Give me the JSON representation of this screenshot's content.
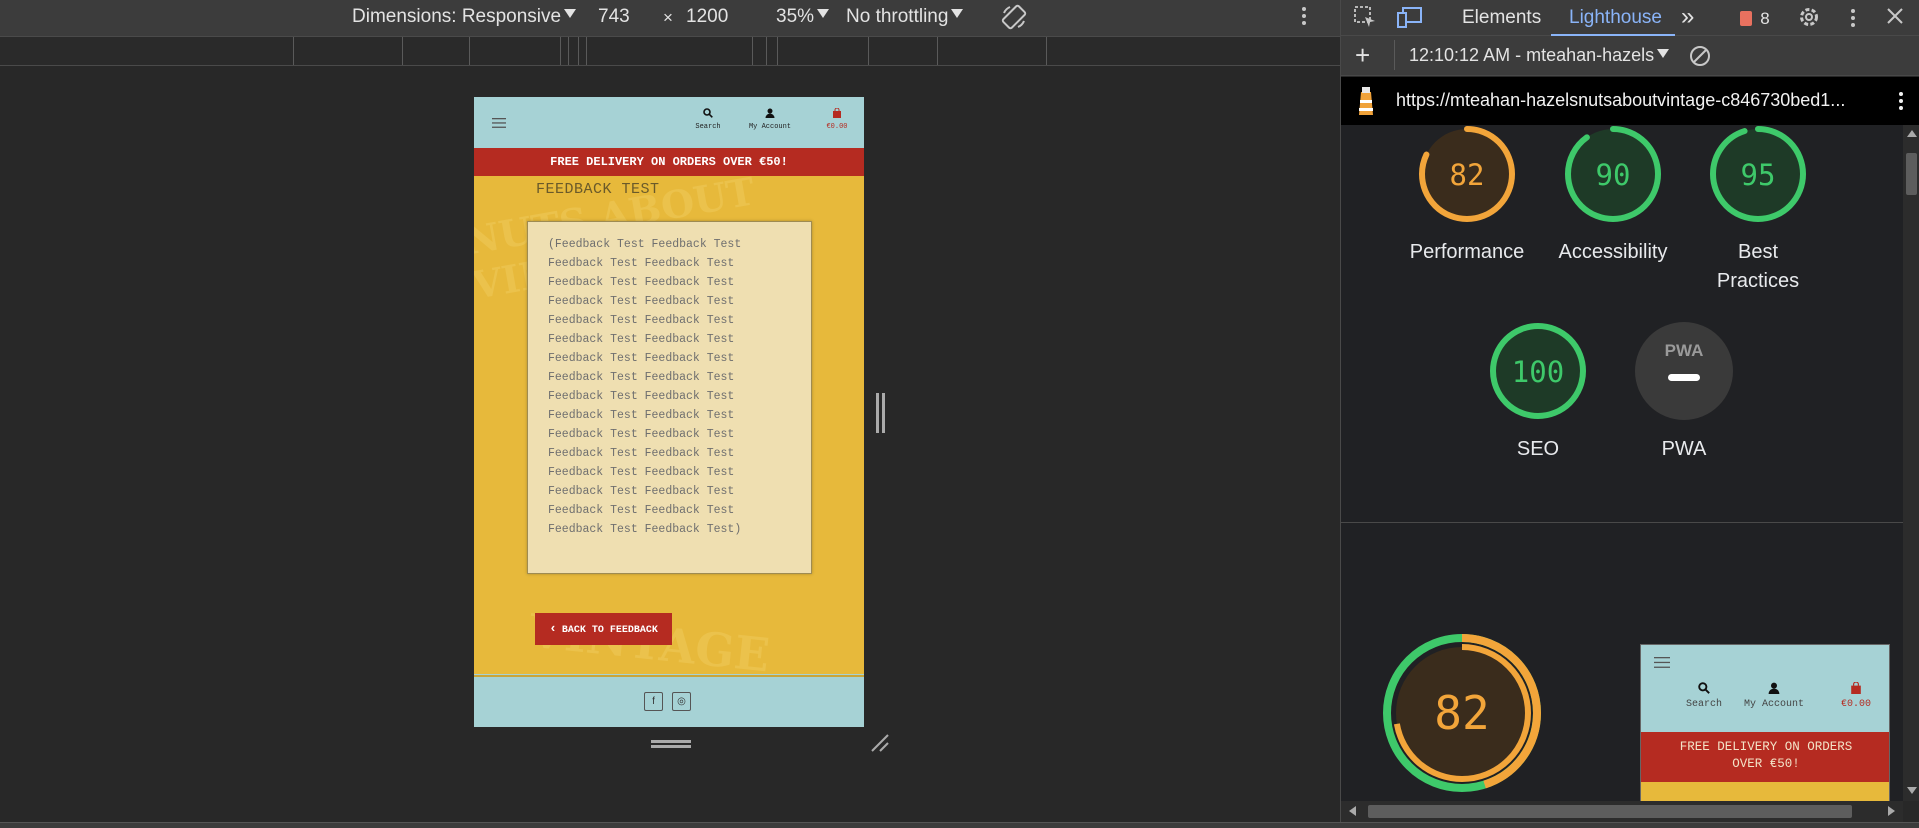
{
  "emulation_toolbar": {
    "dimensions_label": "Dimensions: Responsive",
    "width": "743",
    "times": "×",
    "height": "1200",
    "zoom": "35%",
    "throttling": "No throttling"
  },
  "devtools": {
    "tabs": [
      "Elements",
      "Lighthouse"
    ],
    "active_tab": "Lighthouse",
    "more_tabs_glyph": "»",
    "issues_count": "8",
    "report_selector": "12:10:12 AM - mteahan-hazels",
    "url": "https://mteahan-hazelsnutsaboutvintage-c846730bed1...",
    "scores": [
      {
        "label_line1": "Performance",
        "label_line2": "",
        "value": "82",
        "score": 82,
        "color": "#f2a53a"
      },
      {
        "label_line1": "Accessibility",
        "label_line2": "",
        "value": "90",
        "score": 90,
        "color": "#3ec96a"
      },
      {
        "label_line1": "Best",
        "label_line2": "Practices",
        "value": "95",
        "score": 95,
        "color": "#3ec96a"
      },
      {
        "label_line1": "SEO",
        "label_line2": "",
        "value": "100",
        "score": 100,
        "color": "#3ec96a"
      },
      {
        "label_line1": "PWA",
        "label_line2": "",
        "value": "PWA",
        "score": 0,
        "color": "#888888"
      }
    ],
    "big_score": "82"
  },
  "site": {
    "nav": {
      "search": "Search",
      "account": "My Account",
      "bag_total": "€0.00"
    },
    "banner": "FREE DELIVERY ON ORDERS OVER €50!",
    "bg_word_top": "NUTS ABOUT VINTAGE",
    "bg_word_bottom": "VINTAGE",
    "feedback_title": "FEEDBACK TEST",
    "feedback_text": "(Feedback Test Feedback Test\nFeedback Test Feedback Test\nFeedback Test Feedback Test\nFeedback Test Feedback Test\nFeedback Test Feedback Test\nFeedback Test Feedback Test\nFeedback Test Feedback Test\nFeedback Test Feedback Test\nFeedback Test Feedback Test\nFeedback Test Feedback Test\nFeedback Test Feedback Test\nFeedback Test Feedback Test\nFeedback Test Feedback Test\nFeedback Test Feedback Test\nFeedback Test Feedback Test\nFeedback Test Feedback Test)",
    "back_button": "BACK TO FEEDBACK",
    "social": [
      "f",
      "◎"
    ]
  },
  "thumbnail": {
    "search": "Search",
    "account": "My Account",
    "bag_total": "€0.00",
    "banner_line1": "FREE DELIVERY ON ORDERS",
    "banner_line2": "OVER €50!"
  }
}
